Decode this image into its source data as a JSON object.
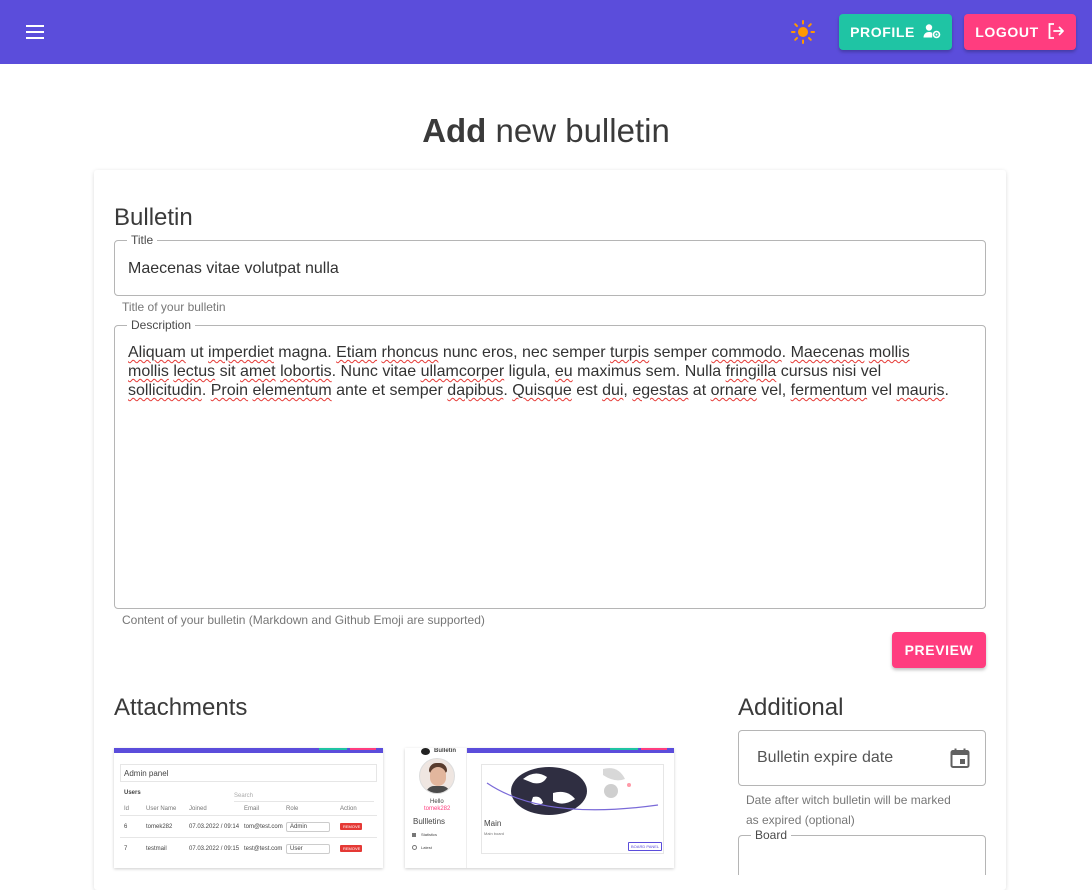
{
  "header": {
    "profile_label": "PROFILE",
    "logout_label": "LOGOUT",
    "icons": {
      "menu": "menu-icon",
      "theme": "sun-icon",
      "profile": "user-gear-icon",
      "logout": "logout-icon"
    },
    "colors": {
      "appbar": "#5b4ddb",
      "profile": "#1fc4a4",
      "logout": "#ff3d7f",
      "sun": "#ff9800"
    }
  },
  "page": {
    "title_bold": "Add",
    "title_rest": " new bulletin"
  },
  "bulletin": {
    "section_title": "Bulletin",
    "title_label": "Title",
    "title_value": "Maecenas vitae volutpat nulla",
    "title_hint": "Title of your bulletin",
    "description_label": "Description",
    "description_hint": "Content of your bulletin (Markdown and Github Emoji are supported)",
    "description_segments": [
      {
        "t": "Aliquam",
        "s": true
      },
      {
        "t": " ut ",
        "s": false
      },
      {
        "t": "imperdiet",
        "s": true
      },
      {
        "t": " magna. ",
        "s": false
      },
      {
        "t": "Etiam",
        "s": true
      },
      {
        "t": " ",
        "s": false
      },
      {
        "t": "rhoncus",
        "s": true
      },
      {
        "t": " nunc eros, nec semper ",
        "s": false
      },
      {
        "t": "turpis",
        "s": true
      },
      {
        "t": " semper ",
        "s": false
      },
      {
        "t": "commodo",
        "s": true
      },
      {
        "t": ". ",
        "s": false
      },
      {
        "t": "Maecenas",
        "s": true
      },
      {
        "t": " ",
        "s": false
      },
      {
        "t": "mollis",
        "s": true
      },
      {
        "t": "\n",
        "s": false
      },
      {
        "t": "mollis",
        "s": true
      },
      {
        "t": " ",
        "s": false
      },
      {
        "t": "lectus",
        "s": true
      },
      {
        "t": " sit ",
        "s": false
      },
      {
        "t": "amet",
        "s": true
      },
      {
        "t": " ",
        "s": false
      },
      {
        "t": "lobortis",
        "s": true
      },
      {
        "t": ". Nunc vitae ",
        "s": false
      },
      {
        "t": "ullamcorper",
        "s": true
      },
      {
        "t": " ligula, ",
        "s": false
      },
      {
        "t": "eu",
        "s": true
      },
      {
        "t": " maximus sem. Nulla ",
        "s": false
      },
      {
        "t": "fringilla",
        "s": true
      },
      {
        "t": " cursus nisi vel\n",
        "s": false
      },
      {
        "t": "sollicitudin",
        "s": true
      },
      {
        "t": ". ",
        "s": false
      },
      {
        "t": "Proin",
        "s": true
      },
      {
        "t": " ",
        "s": false
      },
      {
        "t": "elementum",
        "s": true
      },
      {
        "t": " ante et semper ",
        "s": false
      },
      {
        "t": "dapibus",
        "s": true
      },
      {
        "t": ". ",
        "s": false
      },
      {
        "t": "Quisque",
        "s": true
      },
      {
        "t": " est ",
        "s": false
      },
      {
        "t": "dui",
        "s": true
      },
      {
        "t": ", ",
        "s": false
      },
      {
        "t": "egestas",
        "s": true
      },
      {
        "t": " at ",
        "s": false
      },
      {
        "t": "ornare",
        "s": true
      },
      {
        "t": " vel, ",
        "s": false
      },
      {
        "t": "fermentum",
        "s": true
      },
      {
        "t": " vel ",
        "s": false
      },
      {
        "t": "mauris",
        "s": true
      },
      {
        "t": ".",
        "s": false
      }
    ],
    "preview_label": "PREVIEW"
  },
  "attachments": {
    "section_title": "Attachments",
    "thumb1": {
      "panel_title": "Admin panel",
      "users_label": "Users",
      "search_label": "Search",
      "columns": [
        "Id",
        "User Name",
        "Joined",
        "Email",
        "Role",
        "Action"
      ],
      "rows": [
        [
          "6",
          "tomek282",
          "07.03.2022 / 09:14",
          "tom@test.com",
          "Admin",
          "REMOVE"
        ],
        [
          "7",
          "testmail",
          "07.03.2022 / 09:15",
          "test@test.com",
          "User",
          "REMOVE"
        ]
      ]
    },
    "thumb2": {
      "brand": "Bulletin",
      "hello": "Hello",
      "username": "tomek282",
      "nav_title": "Bullletins",
      "nav_items": [
        "Statistics",
        "Latest"
      ],
      "main_title": "Main",
      "main_sub": "Main board",
      "board_btn": "BOARD PANEL"
    }
  },
  "additional": {
    "section_title": "Additional",
    "expire_placeholder": "Bulletin expire date",
    "expire_hint_line1": "Date after witch bulletin will be marked",
    "expire_hint_line2": "as expired (optional)",
    "board_label": "Board",
    "calendar_icon": "calendar-icon"
  }
}
